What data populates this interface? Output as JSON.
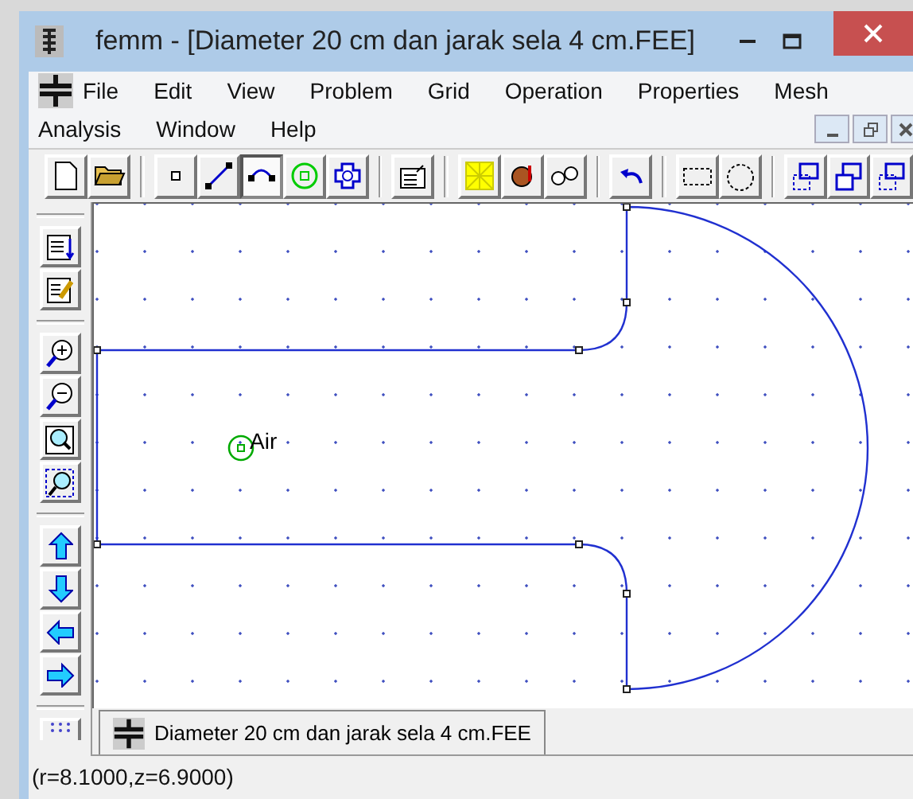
{
  "window": {
    "title": "femm - [Diameter 20 cm dan jarak sela 4 cm.FEE]"
  },
  "menu": [
    "File",
    "Edit",
    "View",
    "Problem",
    "Grid",
    "Operation",
    "Properties",
    "Mesh",
    "Analysis",
    "Window",
    "Help"
  ],
  "draw_modes": [
    {
      "selected": false
    },
    {
      "selected": false
    },
    {
      "selected": true
    },
    {
      "selected": false
    },
    {
      "selected": false
    }
  ],
  "canvas": {
    "block_label": "Air"
  },
  "document_tab": {
    "label": "Diameter 20 cm dan jarak sela 4 cm.FEE",
    "selected": true
  },
  "status_bar": "(r=8.1000,z=6.9000)"
}
